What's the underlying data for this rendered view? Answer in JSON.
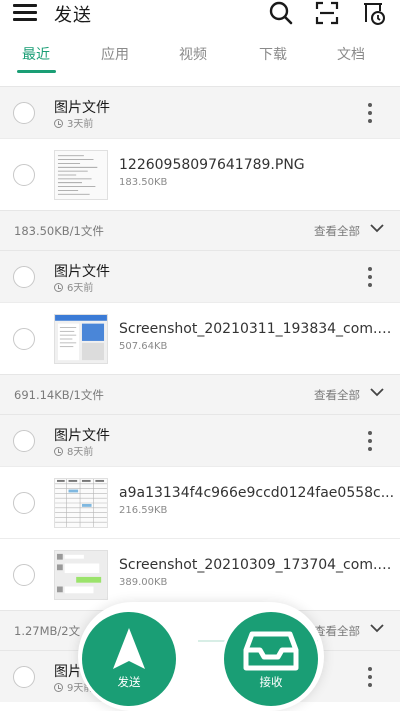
{
  "header": {
    "title": "发送",
    "icons": [
      "menu-icon",
      "search-icon",
      "scan-icon",
      "history-icon"
    ]
  },
  "tabs": [
    {
      "label": "最近",
      "active": true
    },
    {
      "label": "应用",
      "active": false
    },
    {
      "label": "视频",
      "active": false
    },
    {
      "label": "下载",
      "active": false
    },
    {
      "label": "文档",
      "active": false
    }
  ],
  "groups": [
    {
      "title": "图片文件",
      "time": "3天前",
      "files": [
        {
          "name": "12260958097641789.PNG",
          "size": "183.50KB"
        }
      ],
      "summary": "183.50KB/1文件",
      "view_all": "查看全部"
    },
    {
      "title": "图片文件",
      "time": "6天前",
      "files": [
        {
          "name": "Screenshot_20210311_193834_com.t...",
          "size": "507.64KB"
        }
      ],
      "summary": "691.14KB/1文件",
      "view_all": "查看全部"
    },
    {
      "title": "图片文件",
      "time": "8天前",
      "files": [
        {
          "name": "a9a13134f4c966e9ccd0124fae0558c...",
          "size": "216.59KB"
        },
        {
          "name": "Screenshot_20210309_173704_com.t...",
          "size": "389.00KB"
        }
      ],
      "summary": "1.27MB/2文",
      "view_all": "查看全部"
    },
    {
      "title": "图片",
      "time": "9天前"
    }
  ],
  "actions": {
    "send_label": "发送",
    "receive_label": "接收"
  },
  "colors": {
    "accent": "#1a9e75",
    "section_bg": "#f4f4f4"
  }
}
